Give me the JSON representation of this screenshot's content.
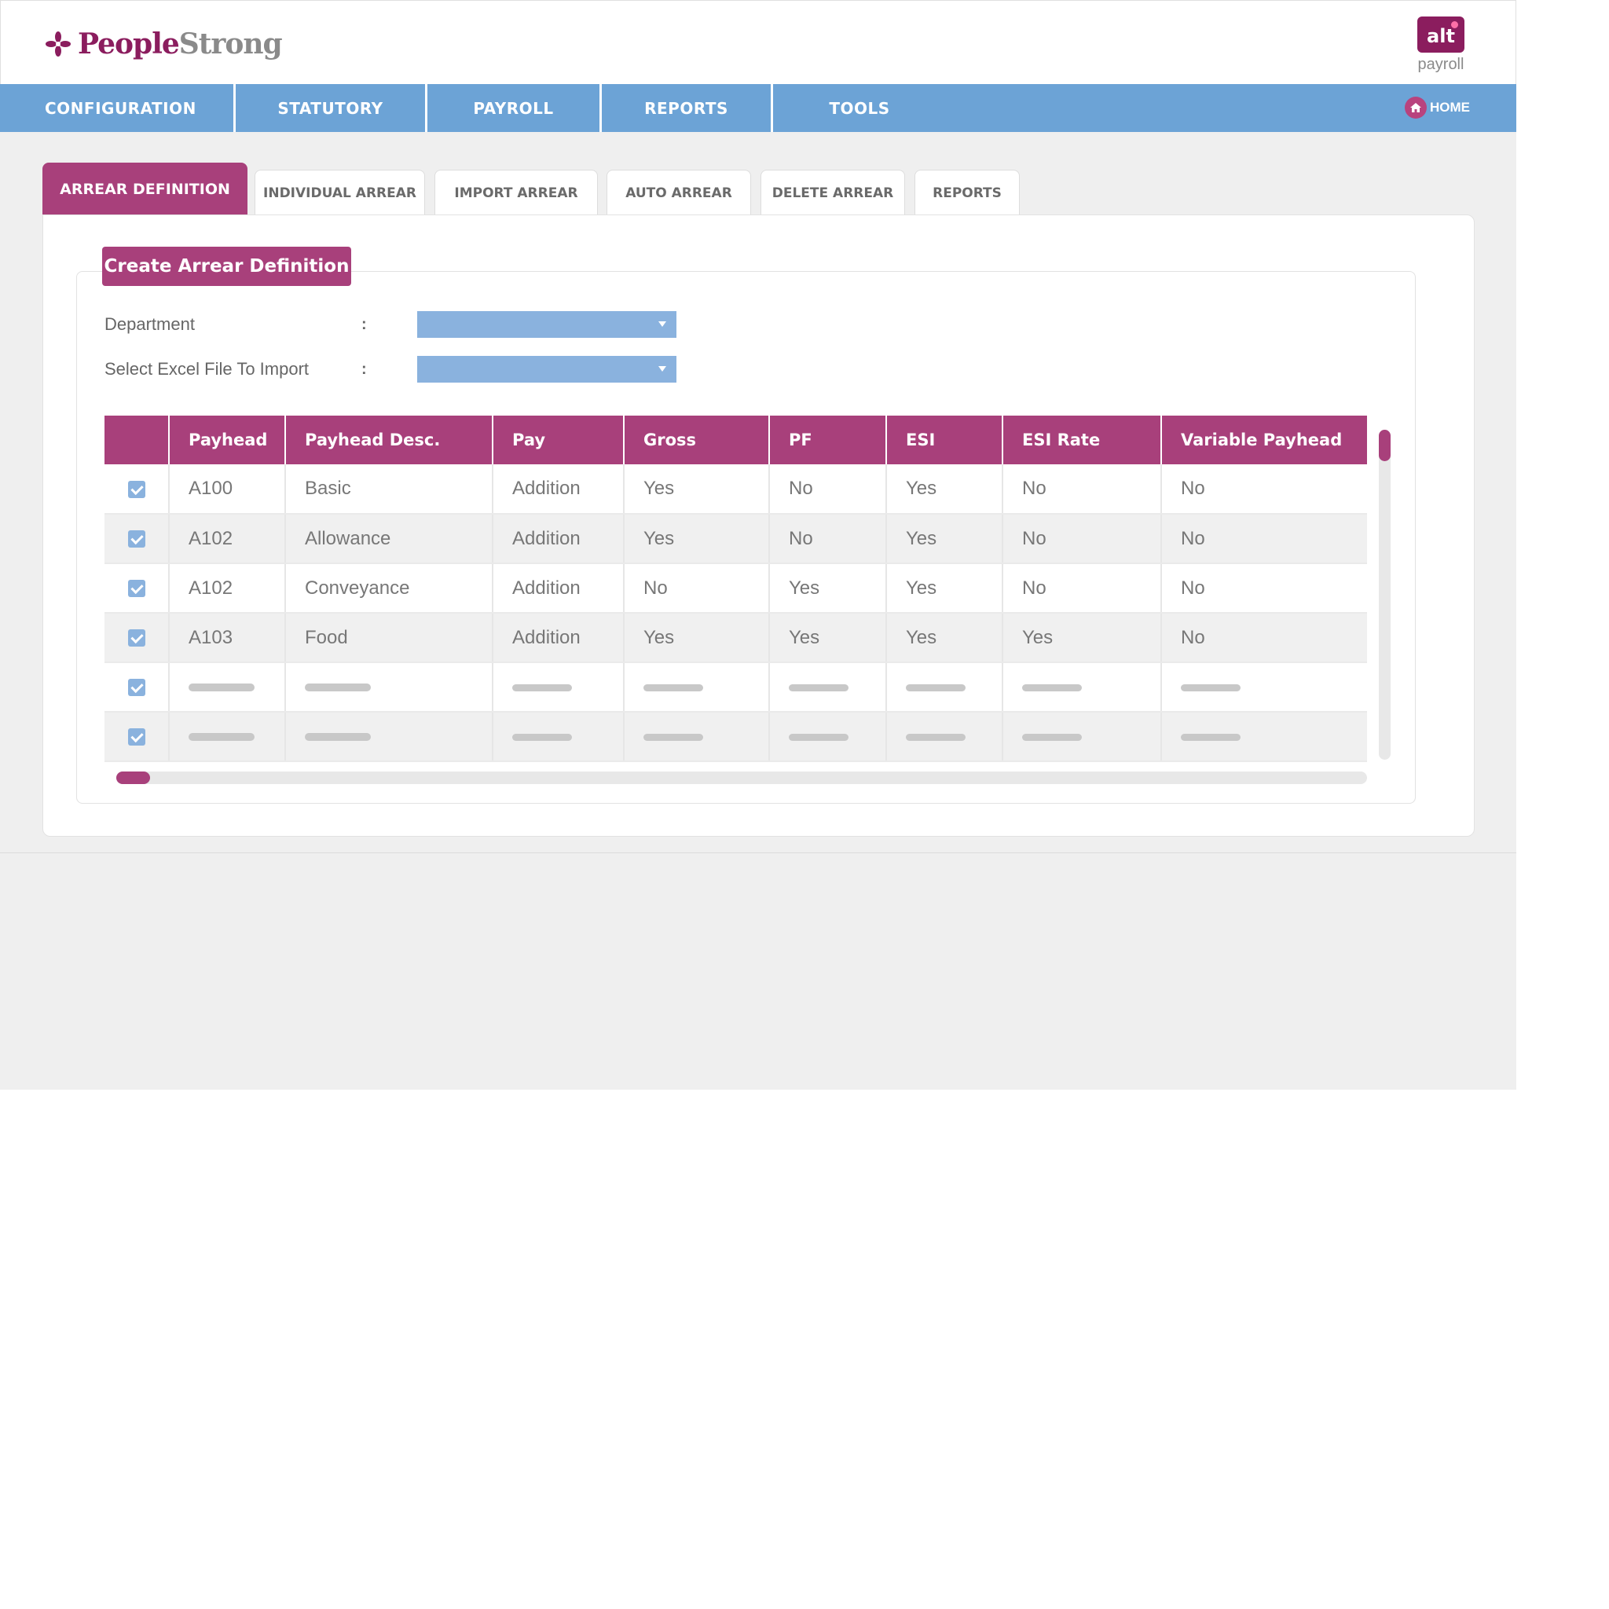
{
  "brand": {
    "name_part1": "People",
    "name_part2": "Strong",
    "product_badge": "alt",
    "product_name": "payroll",
    "colors": {
      "primary": "#8b1d5e",
      "accent": "#a8407b",
      "nav": "#6ca3d6"
    }
  },
  "nav": {
    "items": [
      "CONFIGURATION",
      "STATUTORY",
      "PAYROLL",
      "REPORTS",
      "TOOLS"
    ],
    "home_label": "HOME",
    "home_icon": "home-icon"
  },
  "tabs": [
    {
      "label": "ARREAR DEFINITION",
      "active": true
    },
    {
      "label": "INDIVIDUAL ARREAR",
      "active": false
    },
    {
      "label": "IMPORT ARREAR",
      "active": false
    },
    {
      "label": "AUTO ARREAR",
      "active": false
    },
    {
      "label": "DELETE ARREAR",
      "active": false
    },
    {
      "label": "REPORTS",
      "active": false
    }
  ],
  "form": {
    "title": "Create Arrear Definition",
    "fields": [
      {
        "label": "Department",
        "colon": ":",
        "value": ""
      },
      {
        "label": "Select Excel File To Import",
        "colon": ":",
        "value": ""
      }
    ]
  },
  "table": {
    "headers": [
      "",
      "Payhead",
      "Payhead Desc.",
      "Pay",
      "Gross",
      "PF",
      "ESI",
      "ESI Rate",
      "Variable Payhead"
    ],
    "rows": [
      {
        "checked": true,
        "cells": [
          "A100",
          "Basic",
          "Addition",
          "Yes",
          "No",
          "Yes",
          "No",
          "No"
        ]
      },
      {
        "checked": true,
        "cells": [
          "A102",
          "Allowance",
          "Addition",
          "Yes",
          "No",
          "Yes",
          "No",
          "No"
        ]
      },
      {
        "checked": true,
        "cells": [
          "A102",
          "Conveyance",
          "Addition",
          "No",
          "Yes",
          "Yes",
          "No",
          "No"
        ]
      },
      {
        "checked": true,
        "cells": [
          "A103",
          "Food",
          "Addition",
          "Yes",
          "Yes",
          "Yes",
          "Yes",
          "No"
        ]
      }
    ],
    "placeholder_rows": 2
  }
}
